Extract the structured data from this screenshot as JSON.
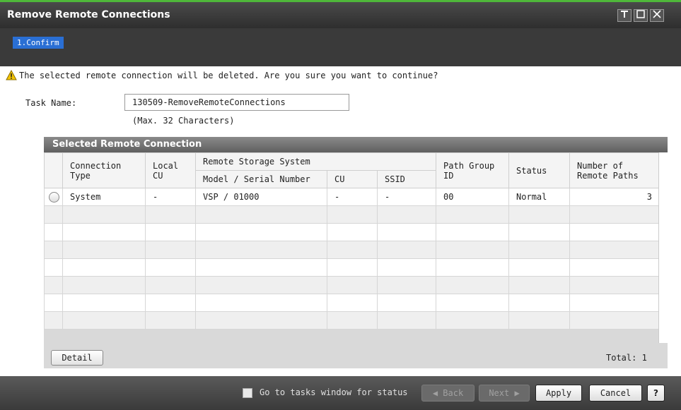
{
  "window": {
    "title": "Remove Remote Connections",
    "controls": [
      "restore-icon",
      "maximize-icon",
      "close-icon"
    ]
  },
  "wizard": {
    "step": "1.Confirm"
  },
  "warning": {
    "icon": "warning-icon",
    "text": "The selected remote connection will be deleted. Are you sure you want to continue?"
  },
  "task": {
    "label": "Task Name:",
    "value": "130509-RemoveRemoteConnections",
    "hint": "(Max. 32 Characters)"
  },
  "panel": {
    "title": "Selected Remote Connection",
    "headers": {
      "connection_type": "Connection Type",
      "local_cu": "Local CU",
      "remote_storage_system": "Remote Storage System",
      "model_serial": "Model / Serial Number",
      "cu": "CU",
      "ssid": "SSID",
      "path_group_id": "Path Group ID",
      "status": "Status",
      "number_of_paths": "Number of Remote Paths"
    },
    "rows": [
      {
        "connection_type": "System",
        "local_cu": "-",
        "model_serial": "VSP / 01000",
        "cu": "-",
        "ssid": "-",
        "path_group_id": "00",
        "status": "Normal",
        "number_of_paths": "3"
      }
    ],
    "detail_button": "Detail",
    "total_label": "Total:",
    "total_value": "1"
  },
  "footer": {
    "checkbox_label": "Go to tasks window for status",
    "back": "Back",
    "next": "Next",
    "apply": "Apply",
    "cancel": "Cancel",
    "help": "?"
  },
  "colors": {
    "accent_green": "#4fb83a",
    "step_blue": "#2a6fd4"
  }
}
